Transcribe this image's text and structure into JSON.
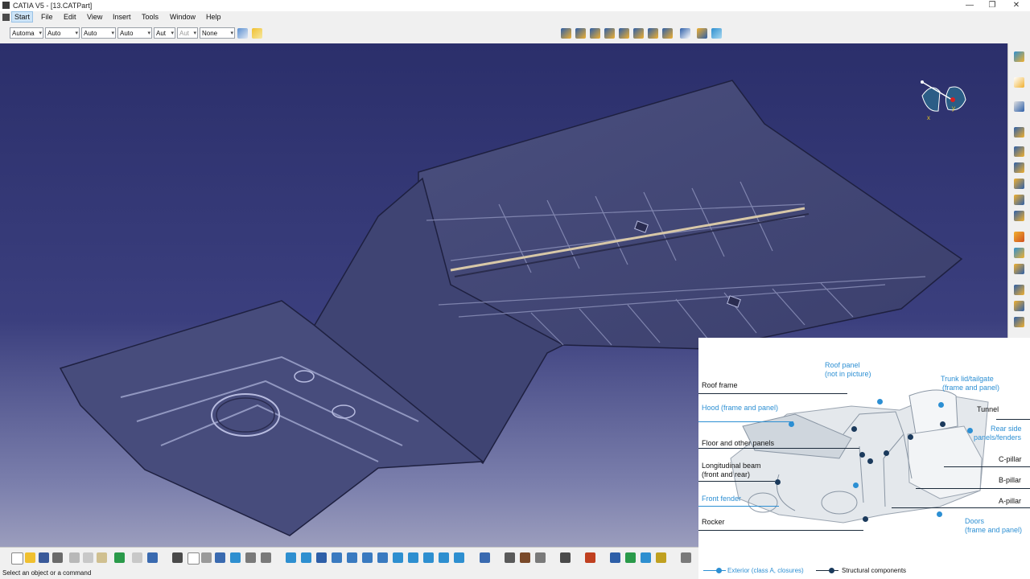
{
  "window": {
    "title": "CATIA V5 - [13.CATPart]",
    "minimize": "—",
    "restore": "❐",
    "close": "✕"
  },
  "menu": [
    "Start",
    "File",
    "Edit",
    "View",
    "Insert",
    "Tools",
    "Window",
    "Help"
  ],
  "toolbar": {
    "combos": [
      {
        "value": "Automa",
        "name": "color-combo"
      },
      {
        "value": "Auto",
        "name": "transparency-combo"
      },
      {
        "value": "Auto",
        "name": "line-thickness-combo"
      },
      {
        "value": "Auto",
        "name": "line-type-combo"
      },
      {
        "value": "Aut",
        "name": "point-type-combo"
      },
      {
        "value": "Aut",
        "name": "rendering-style-combo"
      },
      {
        "value": "None",
        "name": "layer-combo"
      }
    ]
  },
  "status": {
    "message": "Select an object or a command"
  },
  "compass": {
    "x_label": "x",
    "y_label": "y"
  },
  "inset": {
    "labels": {
      "roof_frame": "Roof frame",
      "roof_panel": "Roof panel",
      "roof_panel_note": "(not in picture)",
      "trunk_lid": "Trunk lid/tailgate",
      "trunk_lid_note": "(frame and panel)",
      "hood": "Hood (frame and panel)",
      "tunnel": "Tunnel",
      "floor": "Floor and other panels",
      "rear_side": "Rear side",
      "rear_side_note": "panels/fenders",
      "longitudinal": "Longitudinal beam",
      "longitudinal_note": "(front and rear)",
      "c_pillar": "C-pillar",
      "b_pillar": "B-pillar",
      "front_fender": "Front fender",
      "a_pillar": "A-pillar",
      "rocker": "Rocker",
      "doors": "Doors",
      "doors_note": "(frame and panel)"
    },
    "legend": {
      "exterior": "Exterior (class A, closures)",
      "structural": "Structural components"
    },
    "colors": {
      "exterior": "#2c8fd3",
      "structural": "#1b3a5c"
    }
  }
}
